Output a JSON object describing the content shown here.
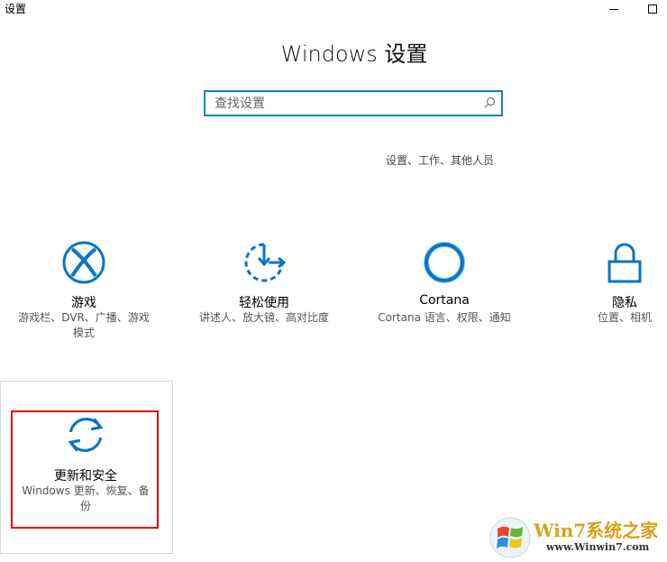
{
  "window": {
    "title": "设置"
  },
  "page": {
    "title": "Windows 设置"
  },
  "search": {
    "placeholder": "查找设置",
    "value": ""
  },
  "scope_link": "设置、工作、其他人员",
  "tiles": [
    {
      "name": "游戏",
      "desc1": "游戏栏、DVR、广播、游戏",
      "desc2": "模式",
      "icon": "xbox-icon"
    },
    {
      "name": "轻松使用",
      "desc1": "讲述人、放大镜、高对比度",
      "desc2": "",
      "icon": "ease-of-access-icon"
    },
    {
      "name": "Cortana",
      "desc1": "Cortana 语言、权限、通知",
      "desc2": "",
      "icon": "cortana-icon"
    },
    {
      "name": "隐私",
      "desc1": "位置、相机",
      "desc2": "",
      "icon": "lock-icon"
    },
    {
      "name": "更新和安全",
      "desc1": "Windows 更新、恢复、备",
      "desc2": "份",
      "icon": "sync-icon"
    }
  ],
  "watermark": {
    "brand": "Win7系统之家",
    "url": "www.Winwin7.com"
  },
  "colors": {
    "accent": "#0078d7",
    "highlight": "#e00000"
  }
}
